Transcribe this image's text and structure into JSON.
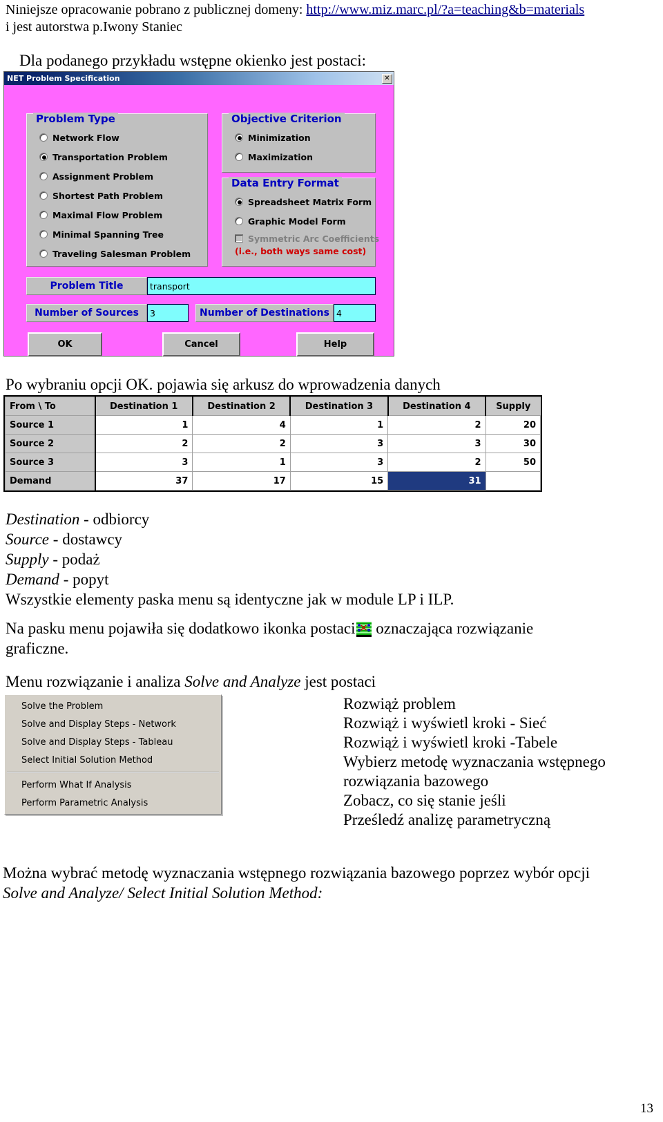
{
  "header": {
    "line1_prefix": "Niniejsze opracowanie pobrano z publicznej domeny: ",
    "link": "http://www.miz.marc.pl/?a=teaching&b=materials",
    "line2": "i jest autorstwa p.Iwony Staniec"
  },
  "intro": "Dla podanego przykładu wstępne okienko jest postaci:",
  "dialog": {
    "title": "NET Problem Specification",
    "close_label": "✕",
    "problem_type": {
      "legend": "Problem Type",
      "options": [
        {
          "label": "Network Flow",
          "selected": false
        },
        {
          "label": "Transportation Problem",
          "selected": true
        },
        {
          "label": "Assignment Problem",
          "selected": false
        },
        {
          "label": "Shortest Path Problem",
          "selected": false
        },
        {
          "label": "Maximal Flow Problem",
          "selected": false
        },
        {
          "label": "Minimal Spanning Tree",
          "selected": false
        },
        {
          "label": "Traveling Salesman Problem",
          "selected": false
        }
      ]
    },
    "objective": {
      "legend": "Objective Criterion",
      "options": [
        {
          "label": "Minimization",
          "selected": true
        },
        {
          "label": "Maximization",
          "selected": false
        }
      ]
    },
    "data_entry": {
      "legend": "Data Entry Format",
      "options": [
        {
          "label": "Spreadsheet Matrix Form",
          "selected": true
        },
        {
          "label": "Graphic Model Form",
          "selected": false
        }
      ],
      "checkbox_label": "Symmetric Arc Coefficients",
      "hint": "(i.e., both ways same cost)",
      "hint_color": "#d00000"
    },
    "problem_title_label": "Problem Title",
    "problem_title_value": "transport",
    "sources_label": "Number of Sources",
    "sources_value": "3",
    "destinations_label": "Number of Destinations",
    "destinations_value": "4",
    "buttons": {
      "ok": "OK",
      "cancel": "Cancel",
      "help": "Help"
    },
    "colors": {
      "background": "#ff66ff",
      "field": "#7ffdfd",
      "label_text": "#0000c0"
    }
  },
  "caption_ok": "Po wybraniu opcji OK. pojawia się arkusz do wprowadzenia danych",
  "sheet": {
    "headers": [
      "From \\ To",
      "Destination 1",
      "Destination 2",
      "Destination 3",
      "Destination 4",
      "Supply"
    ],
    "rows": [
      {
        "name": "Source 1",
        "cells": [
          "1",
          "4",
          "1",
          "2"
        ],
        "supply": "20"
      },
      {
        "name": "Source 2",
        "cells": [
          "2",
          "2",
          "3",
          "3"
        ],
        "supply": "30"
      },
      {
        "name": "Source 3",
        "cells": [
          "3",
          "1",
          "3",
          "2"
        ],
        "supply": "50"
      }
    ],
    "demand": {
      "name": "Demand",
      "cells": [
        "37",
        "17",
        "15",
        "31"
      ],
      "supply": "",
      "selected_index": 3
    },
    "selection_color": "#1f3a80"
  },
  "glossary": [
    {
      "term": "Destination",
      "sep": " - ",
      "def": "odbiorcy"
    },
    {
      "term": "Source",
      "sep": " - ",
      "def": "dostawcy"
    },
    {
      "term": "Supply",
      "sep": " - ",
      "def": "podaż"
    },
    {
      "term": "Demand",
      "sep": " - ",
      "def": "popyt"
    }
  ],
  "para_menu_same": "Wszystkie elementy paska menu są identyczne jak w module LP i ILP.",
  "para_icon_pre": "Na pasku menu pojawiła się dodatkowo ikonka postaci",
  "para_icon_post": " oznaczająca rozwiązanie",
  "para_icon_line2": "graficzne.",
  "para_menu_intro_pre": "Menu rozwiązanie i analiza ",
  "para_menu_intro_ital": "Solve and Analyze",
  "para_menu_intro_post": " jest postaci",
  "menu": {
    "items": [
      "Solve the Problem",
      "Solve and Display Steps - Network",
      "Solve and Display Steps - Tableau",
      "Select Initial Solution Method"
    ],
    "items2": [
      "Perform What If Analysis",
      "Perform Parametric Analysis"
    ]
  },
  "translations": [
    "Rozwiąż problem",
    "Rozwiąż i wyświetl kroki - Sieć",
    "Rozwiąż i wyświetl kroki -Tabele",
    "Wybierz metodę wyznaczania wstępnego",
    "rozwiązania bazowego",
    "Zobacz, co się stanie jeśli",
    "Prześledź analizę parametryczną"
  ],
  "closing": {
    "line1": "Można wybrać metodę wyznaczania wstępnego rozwiązania bazowego poprzez wybór opcji",
    "line2_ital": "Solve and Analyze/ Select Initial Solution Method:"
  },
  "page_number": "13"
}
